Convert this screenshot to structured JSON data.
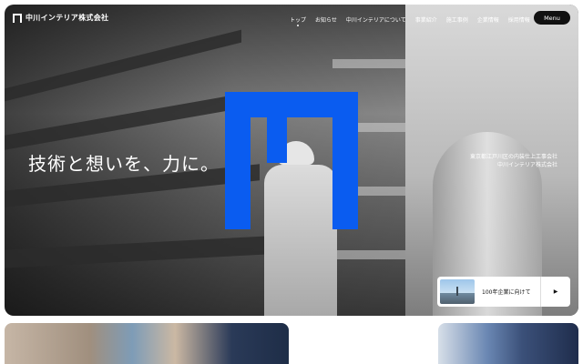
{
  "header": {
    "logo_text": "中川インテリア株式会社",
    "nav": [
      {
        "label": "トップ",
        "active": true
      },
      {
        "label": "お知らせ",
        "active": false
      },
      {
        "label": "中川インテリアについて",
        "active": false
      },
      {
        "label": "事業紹介",
        "active": false
      },
      {
        "label": "施工事例",
        "active": false
      },
      {
        "label": "企業情報",
        "active": false
      },
      {
        "label": "採用情報",
        "active": false
      }
    ],
    "menu_label": "Menu"
  },
  "hero": {
    "headline": "技術と想いを、力に。",
    "tagline_line1": "東京都江戸川区の内装仕上工事会社",
    "tagline_line2": "中川インテリア株式会社",
    "brand_color": "#0a5cf0"
  },
  "promo": {
    "label": "100年企業に向けて",
    "arrow": "▶"
  },
  "icons": {
    "logo_mark": "logo-n-icon",
    "brand_mark": "brand-n-icon",
    "play": "play-icon"
  }
}
